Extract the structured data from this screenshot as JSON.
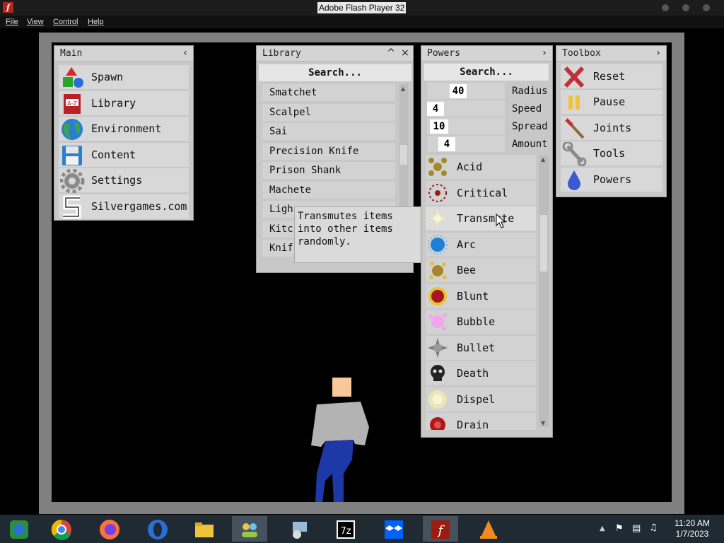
{
  "window": {
    "title": "Adobe Flash Player 32"
  },
  "menubar": {
    "items": [
      "File",
      "View",
      "Control",
      "Help"
    ]
  },
  "main_panel": {
    "title": "Main",
    "items": [
      {
        "label": "Spawn",
        "icon": "spawn-shapes-icon"
      },
      {
        "label": "Library",
        "icon": "library-book-icon"
      },
      {
        "label": "Environment",
        "icon": "globe-icon"
      },
      {
        "label": "Content",
        "icon": "floppy-disk-icon"
      },
      {
        "label": "Settings",
        "icon": "gear-icon"
      },
      {
        "label": "Silvergames.com",
        "icon": "silvergames-logo-icon"
      }
    ]
  },
  "library_panel": {
    "title": "Library",
    "search": "Search...",
    "items": [
      "Smatchet",
      "Scalpel",
      "Sai",
      "Precision Knife",
      "Prison Shank",
      "Machete",
      "Ligh",
      "Kitc",
      "Knif"
    ]
  },
  "tooltip": {
    "text": "Transmutes items into other items randomly."
  },
  "powers_panel": {
    "title": "Powers",
    "search": "Search...",
    "params": [
      {
        "value": "40",
        "label": "Radius"
      },
      {
        "value": "4",
        "label": "Speed"
      },
      {
        "value": "10",
        "label": "Spread"
      },
      {
        "value": "4",
        "label": "Amount"
      }
    ],
    "items": [
      {
        "label": "Acid",
        "color": "#a38a2a"
      },
      {
        "label": "Critical",
        "color": "#9c1b1b"
      },
      {
        "label": "Transmute",
        "color": "#f3ecb0"
      },
      {
        "label": "Arc",
        "color": "#1e7fd6"
      },
      {
        "label": "Bee",
        "color": "#a8862a"
      },
      {
        "label": "Blunt",
        "color": "#a51620"
      },
      {
        "label": "Bubble",
        "color": "#f2a4ec"
      },
      {
        "label": "Bullet",
        "color": "#7a7a7a"
      },
      {
        "label": "Death",
        "color": "#222222"
      },
      {
        "label": "Dispel",
        "color": "#ece6b6"
      },
      {
        "label": "Drain",
        "color": "#b01818"
      }
    ]
  },
  "toolbox_panel": {
    "title": "Toolbox",
    "items": [
      {
        "label": "Reset",
        "icon": "x-reset-icon"
      },
      {
        "label": "Pause",
        "icon": "pause-icon"
      },
      {
        "label": "Joints",
        "icon": "joints-icon"
      },
      {
        "label": "Tools",
        "icon": "wrench-icon"
      },
      {
        "label": "Powers",
        "icon": "powers-drop-icon"
      }
    ]
  },
  "taskbar": {
    "apps": [
      "vm-app",
      "chrome",
      "firefox",
      "opera",
      "file-explorer",
      "people-app",
      "network-setup",
      "7zip",
      "dropbox",
      "flash-player",
      "vlc"
    ],
    "time": "11:20 AM",
    "date": "1/7/2023"
  }
}
